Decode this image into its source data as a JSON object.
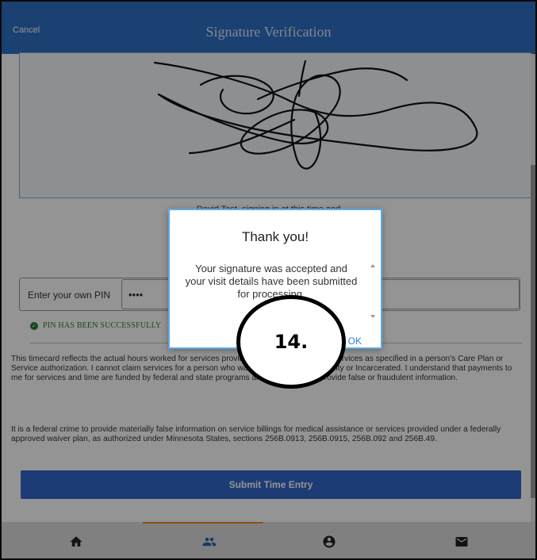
{
  "header": {
    "cancel_label": "Cancel",
    "title": "Signature Verification"
  },
  "signature": {
    "caption": "David Test, signing in at this time and"
  },
  "pin": {
    "label": "Enter your own PIN",
    "value": "••••",
    "success_text": "PIN HAS BEEN SUCCESSFULLY"
  },
  "legal": {
    "paragraph1": "This timecard reflects the actual hours worked for services provided by me or on behalf of services as specified in a person's Care Plan or Service authorization. I cannot claim services for a person who was in a hospital, Care facility or Incarcerated. I understand that payments to me for services and time are funded by federal and state programs and it is a crime to provide false or fraudulent information.",
    "paragraph2": "It is a federal crime to provide materially false information on service billings for medical assistance or services provided under a federally approved waiver plan, as authorized under Minnesota States, sections 256B.0913, 256B.0915, 256B.092 and 256B.49."
  },
  "submit_label": "Submit Time Entry",
  "nav": {
    "items": [
      {
        "icon": "home-icon"
      },
      {
        "icon": "people-icon"
      },
      {
        "icon": "account-icon"
      },
      {
        "icon": "mail-icon"
      }
    ],
    "active_index": 1
  },
  "modal": {
    "title": "Thank you!",
    "message": "Your signature was accepted and your visit details have been submitted for processing.",
    "ok_label": "OK"
  },
  "callout": {
    "label": "14."
  },
  "colors": {
    "header": "#2f6ec4",
    "submit": "#3366c8",
    "nav_active": "#f08a24",
    "success": "#2e7d32",
    "modal_border": "#5aa9e6"
  }
}
